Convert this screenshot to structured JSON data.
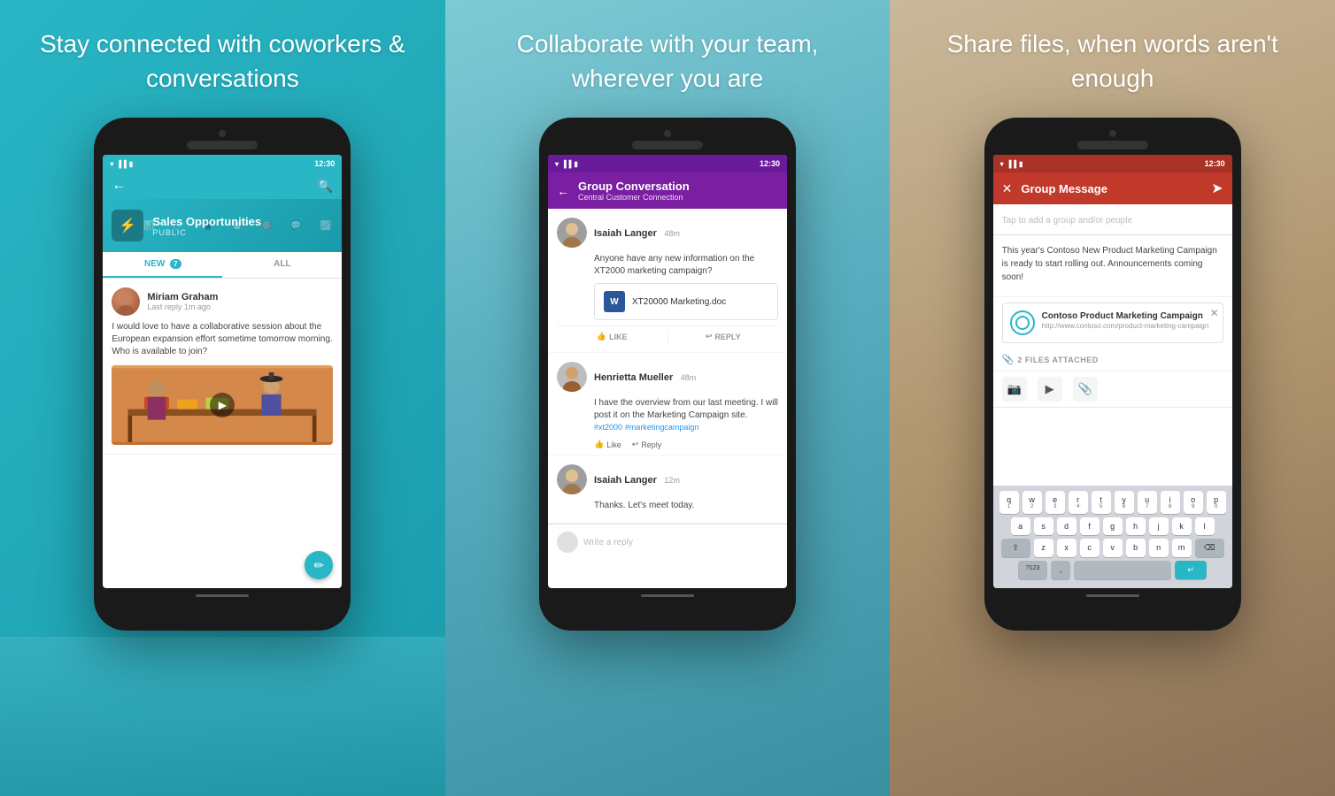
{
  "panels": [
    {
      "id": "panel-1",
      "heading": "Stay connected with\ncoworkers & conversations",
      "background": "teal",
      "phone": {
        "status_time": "12:30",
        "header_color": "#29b6c5",
        "group_name": "Sales Opportunities",
        "group_type": "PUBLIC",
        "group_icon": "⚡",
        "tabs": [
          {
            "label": "NEW",
            "badge": "7",
            "active": true
          },
          {
            "label": "ALL",
            "active": false
          }
        ],
        "feed": [
          {
            "user": "Miriam Graham",
            "time": "Last reply 1m ago",
            "text": "I would love to have a collaborative session about the European expansion effort sometime tomorrow morning. Who is available to join?",
            "has_image": true
          }
        ],
        "back_button": "←",
        "search_icon": "🔍",
        "fab_icon": "✏️"
      }
    },
    {
      "id": "panel-2",
      "heading": "Collaborate with your\nteam, wherever you are",
      "background": "teal-mid",
      "phone": {
        "status_time": "12:30",
        "header_color": "#7b1fa2",
        "conversation_title": "Group Conversation",
        "conversation_subtitle": "Central Customer Connection",
        "back_button": "←",
        "messages": [
          {
            "user": "Isaiah Langer",
            "time": "48m",
            "text": "Anyone have any new information on the XT2000 marketing campaign?",
            "attachment": {
              "type": "word",
              "name": "XT20000 Marketing.doc"
            },
            "actions_big": [
              "LIKE",
              "REPLY"
            ]
          },
          {
            "user": "Henrietta Mueller",
            "time": "48m",
            "text": "I have the overview from our last meeting. I will post it on the Marketing Campaign site. #xt2000 #marketingcampaign",
            "actions_small": [
              "Like",
              "Reply"
            ]
          },
          {
            "user": "Isaiah Langer",
            "time": "12m",
            "text": "Thanks. Let's meet today."
          }
        ],
        "reply_placeholder": "Write a reply"
      }
    },
    {
      "id": "panel-3",
      "heading": "Share files, when\nwords aren't enough",
      "background": "warm",
      "phone": {
        "status_time": "12:30",
        "header_color": "#c0392b",
        "screen_title": "Group Message",
        "close_icon": "✕",
        "send_icon": "➤",
        "recipients_placeholder": "Tap to add a group and/or people",
        "message_text": "This year's Contoso New Product Marketing Campaign is ready to start rolling out. Announcements coming soon!",
        "link_preview": {
          "title": "Contoso Product Marketing Campaign",
          "url": "http://www.contoso.com/product-marketing-campaign"
        },
        "files_count": "2 FILES ATTACHED",
        "keyboard": {
          "rows": [
            [
              "q",
              "w",
              "e",
              "r",
              "t",
              "y",
              "u",
              "i",
              "o",
              "p"
            ],
            [
              "a",
              "s",
              "d",
              "f",
              "g",
              "h",
              "j",
              "k",
              "l"
            ],
            [
              "⇧",
              "z",
              "x",
              "c",
              "v",
              "b",
              "n",
              "m",
              "⌫"
            ],
            [
              "?123",
              ",",
              "",
              "",
              "",
              "",
              "",
              "",
              "",
              "↵"
            ]
          ]
        }
      }
    }
  ]
}
